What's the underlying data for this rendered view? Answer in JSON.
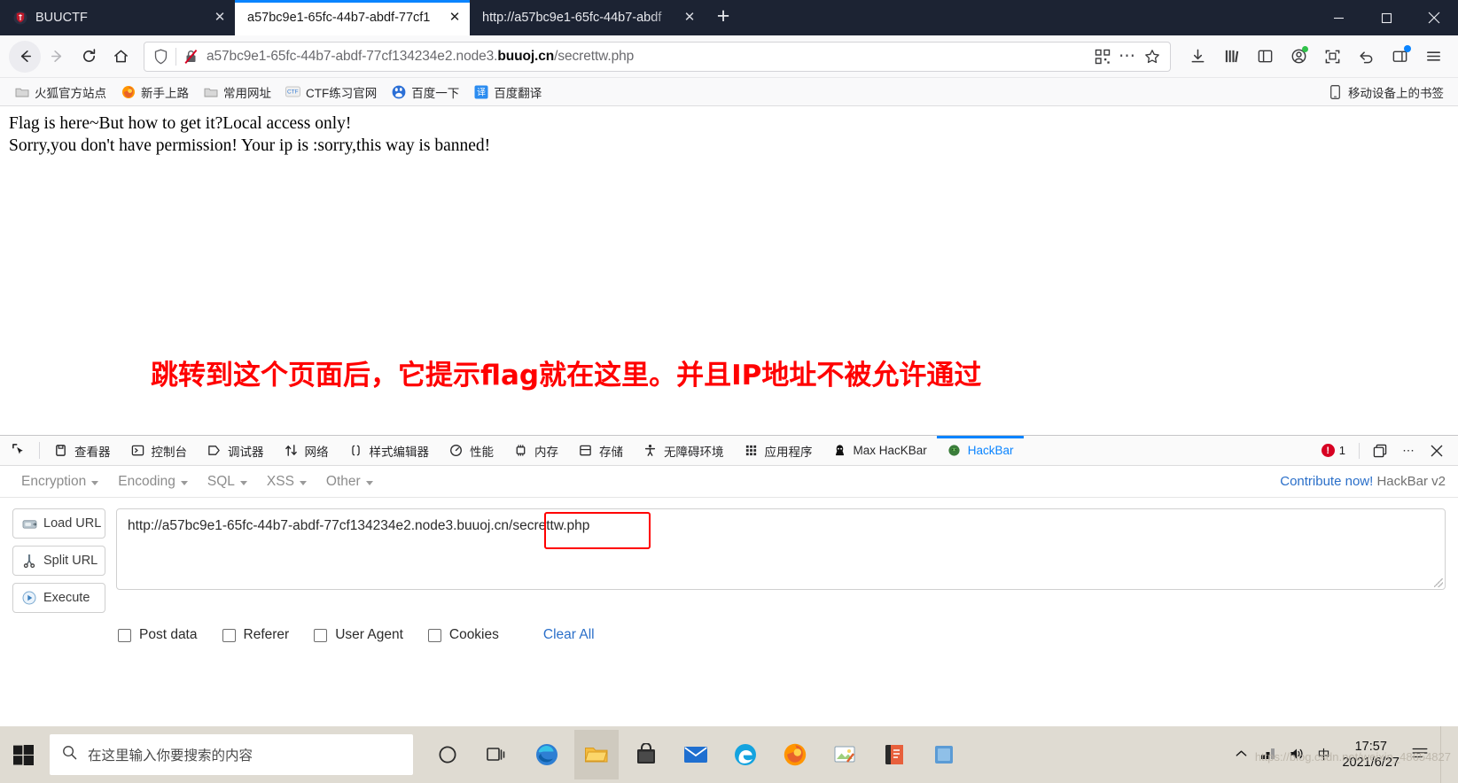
{
  "window": {
    "tabs": [
      {
        "title": "BUUCTF",
        "favicon": "buuctf-logo",
        "active": false
      },
      {
        "title": "a57bc9e1-65fc-44b7-abdf-77cf1",
        "favicon": "none",
        "active": true
      },
      {
        "title": "http://a57bc9e1-65fc-44b7-abdf",
        "favicon": "none",
        "active": false
      }
    ],
    "new_tab_label": "+",
    "controls": {
      "minimize": "—",
      "maximize": "❐",
      "close": "✕"
    }
  },
  "nav": {
    "back_icon": "back-arrow-icon",
    "forward_icon": "forward-arrow-icon",
    "reload_icon": "reload-icon",
    "home_icon": "home-icon",
    "url": "a57bc9e1-65fc-44b7-abdf-77cf134234e2.node3.",
    "url_domain": "buuoj.cn",
    "url_path": "/secrettw.php",
    "qr_icon": "qr-code-icon",
    "page_actions_icon": "ellipsis-icon",
    "bookmark_star_icon": "star-icon",
    "toolbar_icons": [
      "downloads-icon",
      "library-icon",
      "sidebar-icon",
      "account-icon",
      "screenshot-icon",
      "undo-icon",
      "container-icon",
      "menu-icon"
    ]
  },
  "bookmarks": {
    "items": [
      {
        "label": "火狐官方站点",
        "icon": "folder-icon"
      },
      {
        "label": "新手上路",
        "icon": "firefox-icon"
      },
      {
        "label": "常用网址",
        "icon": "folder-icon"
      },
      {
        "label": "CTF练习官网",
        "icon": "ctf-icon"
      },
      {
        "label": "百度一下",
        "icon": "baidu-icon"
      },
      {
        "label": "百度翻译",
        "icon": "fanyi-icon"
      }
    ],
    "mobile_label": "移动设备上的书签",
    "mobile_icon": "phone-icon"
  },
  "page": {
    "line1": "Flag is here~But how to get it?Local access only!",
    "line2": "Sorry,you don't have permission! Your ip is :sorry,this way is banned!",
    "annotation": "跳转到这个页面后，它提示flag就在这里。并且IP地址不被允许通过",
    "annotation_color": "#ff0000"
  },
  "devtools": {
    "picker_icon": "element-picker-icon",
    "tabs": [
      {
        "label": "查看器",
        "icon": "inspector-icon",
        "active": false
      },
      {
        "label": "控制台",
        "icon": "console-icon",
        "active": false
      },
      {
        "label": "调试器",
        "icon": "debugger-icon",
        "active": false
      },
      {
        "label": "网络",
        "icon": "network-icon",
        "active": false
      },
      {
        "label": "样式编辑器",
        "icon": "style-editor-icon",
        "active": false
      },
      {
        "label": "性能",
        "icon": "performance-icon",
        "active": false
      },
      {
        "label": "内存",
        "icon": "memory-icon",
        "active": false
      },
      {
        "label": "存储",
        "icon": "storage-icon",
        "active": false
      },
      {
        "label": "无障碍环境",
        "icon": "accessibility-icon",
        "active": false
      },
      {
        "label": "应用程序",
        "icon": "application-icon",
        "active": false
      },
      {
        "label": "Max HacKBar",
        "icon": "max-hackbar-icon",
        "active": false
      },
      {
        "label": "HackBar",
        "icon": "hackbar-icon",
        "active": true
      }
    ],
    "error_count": "1",
    "split_console_icon": "split-console-icon",
    "more_icon": "ellipsis-icon",
    "close_icon": "close-icon"
  },
  "hackbar": {
    "menus": [
      "Encryption",
      "Encoding",
      "SQL",
      "XSS",
      "Other"
    ],
    "contribute_link": "Contribute now!",
    "version_label": "HackBar v2",
    "buttons": [
      {
        "label": "Load URL",
        "icon": "load-url-icon"
      },
      {
        "label": "Split URL",
        "icon": "split-url-icon"
      },
      {
        "label": "Execute",
        "icon": "execute-icon"
      }
    ],
    "url_value": "http://a57bc9e1-65fc-44b7-abdf-77cf134234e2.node3.buuoj.cn/secrettw.php",
    "url_placeholder": "",
    "checkboxes": [
      {
        "label": "Post data",
        "checked": false
      },
      {
        "label": "Referer",
        "checked": false
      },
      {
        "label": "User Agent",
        "checked": false
      },
      {
        "label": "Cookies",
        "checked": false
      }
    ],
    "clear_all": "Clear All",
    "highlight_color": "#ff0000"
  },
  "taskbar": {
    "start_icon": "windows-start-icon",
    "search_placeholder": "在这里输入你要搜索的内容",
    "search_icon": "search-icon",
    "apps": [
      "cortana-icon",
      "task-view-icon",
      "edge-chromium-icon",
      "file-explorer-icon",
      "store-icon",
      "mail-icon",
      "edge-legacy-icon",
      "firefox-icon",
      "snipping-tool-icon",
      "pdf-icon",
      "teams-icon"
    ],
    "tray": {
      "chevron_icon": "chevron-up-icon",
      "network_icon": "network-tray-icon",
      "volume_icon": "volume-icon",
      "ime_label": "中",
      "time": "17:57",
      "date": "2021/6/27",
      "notification_icon": "action-center-icon"
    }
  },
  "watermark": "https://blog.csdn.net/weixin_48654827"
}
